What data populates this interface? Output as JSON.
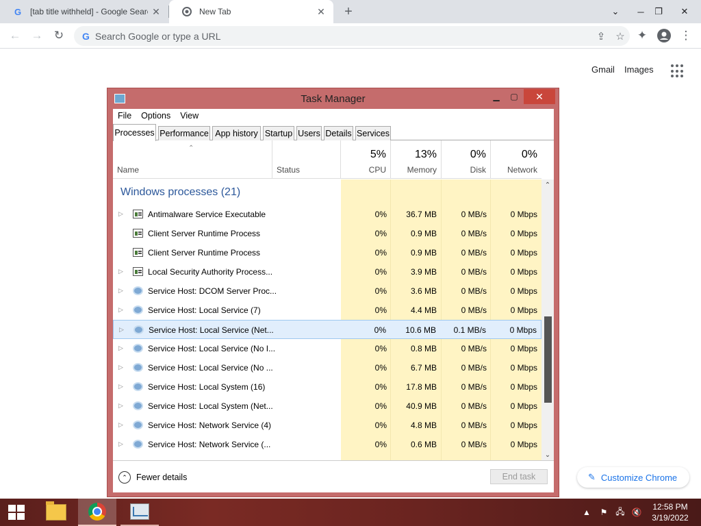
{
  "browser": {
    "tabs": [
      {
        "title": "[tab title withheld] - Google Search",
        "favicon": "google-g-icon",
        "active": false
      },
      {
        "title": "New Tab",
        "favicon": "chrome-icon",
        "active": true
      }
    ],
    "new_tab_symbol": "+",
    "omnibox": {
      "placeholder": "Search Google or type a URL"
    },
    "ntp": {
      "links": [
        "Gmail",
        "Images"
      ],
      "customize_label": "Customize Chrome"
    }
  },
  "task_manager": {
    "title": "Task Manager",
    "menu": [
      "File",
      "Options",
      "View"
    ],
    "tabs": [
      "Processes",
      "Performance",
      "App history",
      "Startup",
      "Users",
      "Details",
      "Services"
    ],
    "active_tab": "Processes",
    "columns": {
      "name": "Name",
      "status": "Status",
      "cpu": {
        "pct": "5%",
        "label": "CPU"
      },
      "memory": {
        "pct": "13%",
        "label": "Memory"
      },
      "disk": {
        "pct": "0%",
        "label": "Disk"
      },
      "network": {
        "pct": "0%",
        "label": "Network"
      }
    },
    "section": "Windows processes (21)",
    "processes": [
      {
        "name": "Antimalware Service Executable",
        "icon": "exe",
        "expandable": true,
        "cpu": "0%",
        "memory": "36.7 MB",
        "disk": "0 MB/s",
        "network": "0 Mbps"
      },
      {
        "name": "Client Server Runtime Process",
        "icon": "exe",
        "expandable": false,
        "cpu": "0%",
        "memory": "0.9 MB",
        "disk": "0 MB/s",
        "network": "0 Mbps"
      },
      {
        "name": "Client Server Runtime Process",
        "icon": "exe",
        "expandable": false,
        "cpu": "0%",
        "memory": "0.9 MB",
        "disk": "0 MB/s",
        "network": "0 Mbps"
      },
      {
        "name": "Local Security Authority Process...",
        "icon": "exe",
        "expandable": true,
        "cpu": "0%",
        "memory": "3.9 MB",
        "disk": "0 MB/s",
        "network": "0 Mbps"
      },
      {
        "name": "Service Host: DCOM Server Proc...",
        "icon": "gear",
        "expandable": true,
        "cpu": "0%",
        "memory": "3.6 MB",
        "disk": "0 MB/s",
        "network": "0 Mbps"
      },
      {
        "name": "Service Host: Local Service (7)",
        "icon": "gear",
        "expandable": true,
        "cpu": "0%",
        "memory": "4.4 MB",
        "disk": "0 MB/s",
        "network": "0 Mbps"
      },
      {
        "name": "Service Host: Local Service (Net...",
        "icon": "gear",
        "expandable": true,
        "cpu": "0%",
        "memory": "10.6 MB",
        "disk": "0.1 MB/s",
        "network": "0 Mbps",
        "selected": true
      },
      {
        "name": "Service Host: Local Service (No I...",
        "icon": "gear",
        "expandable": true,
        "cpu": "0%",
        "memory": "0.8 MB",
        "disk": "0 MB/s",
        "network": "0 Mbps"
      },
      {
        "name": "Service Host: Local Service (No ...",
        "icon": "gear",
        "expandable": true,
        "cpu": "0%",
        "memory": "6.7 MB",
        "disk": "0 MB/s",
        "network": "0 Mbps"
      },
      {
        "name": "Service Host: Local System (16)",
        "icon": "gear",
        "expandable": true,
        "cpu": "0%",
        "memory": "17.8 MB",
        "disk": "0 MB/s",
        "network": "0 Mbps"
      },
      {
        "name": "Service Host: Local System (Net...",
        "icon": "gear",
        "expandable": true,
        "cpu": "0%",
        "memory": "40.9 MB",
        "disk": "0 MB/s",
        "network": "0 Mbps"
      },
      {
        "name": "Service Host: Network Service (4)",
        "icon": "gear",
        "expandable": true,
        "cpu": "0%",
        "memory": "4.8 MB",
        "disk": "0 MB/s",
        "network": "0 Mbps"
      },
      {
        "name": "Service Host: Network Service (...",
        "icon": "gear",
        "expandable": true,
        "cpu": "0%",
        "memory": "0.6 MB",
        "disk": "0 MB/s",
        "network": "0 Mbps"
      }
    ],
    "footer": {
      "fewer_details": "Fewer details",
      "end_task": "End task"
    }
  },
  "taskbar": {
    "items": [
      "file-explorer-icon",
      "chrome-icon",
      "task-manager-icon"
    ],
    "clock": {
      "time": "12:58 PM",
      "date": "3/19/2022"
    }
  },
  "colors": {
    "tm_frame": "#c56c6c",
    "usage_yellow": "#fff4c4",
    "section_blue": "#2b579a",
    "chrome_link_blue": "#1a73e8"
  }
}
